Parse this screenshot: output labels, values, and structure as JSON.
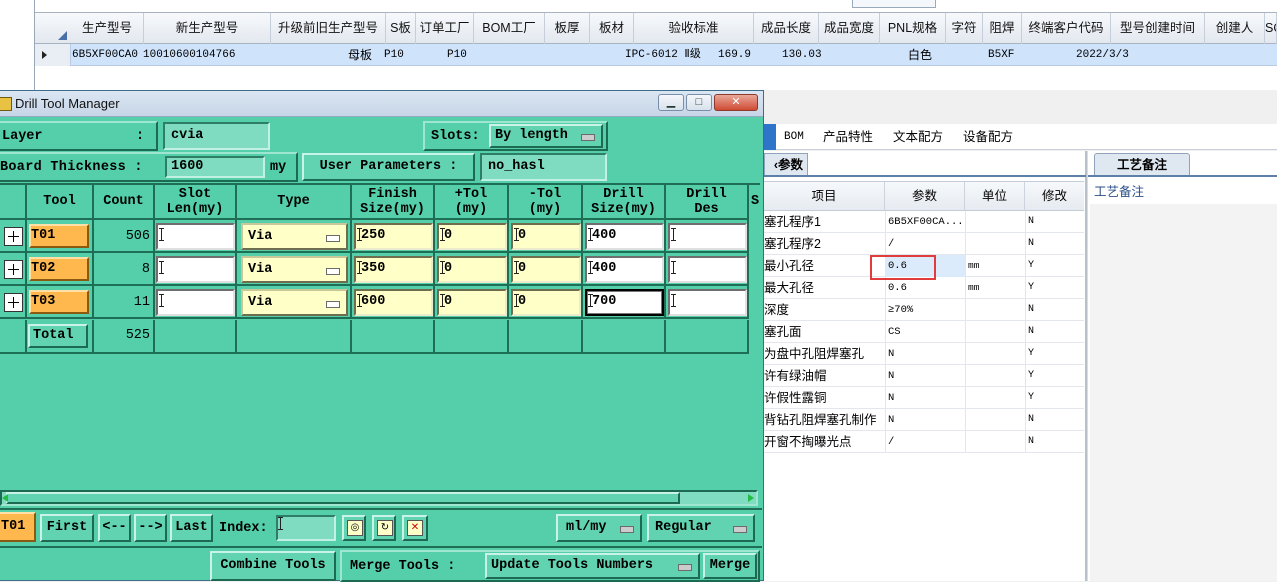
{
  "top_grid": {
    "columns": [
      "生产型号",
      "新生产型号",
      "升级前旧生产型号",
      "S板",
      "订单工厂",
      "BOM工厂",
      "板厚",
      "板材",
      "验收标准",
      "成品长度",
      "成品宽度",
      "PNL规格",
      "字符",
      "阻焊",
      "终端客户代码",
      "型号创建时间",
      "创建人",
      "SO"
    ],
    "row": {
      "model": "6B5XF00CA0",
      "new_model": "10010600104766",
      "s_board": "母板",
      "order_factory": "P10",
      "bom_factory": "P10",
      "acceptance": "IPC-6012 Ⅱ级",
      "length": "169.9",
      "width": "130.03",
      "char": "白色",
      "customer_code": "B5XF",
      "created": "2022/3/3"
    }
  },
  "sub_tabs": [
    "BOM",
    "产品特性",
    "文本配方",
    "设备配方"
  ],
  "param_panel": {
    "tab_label": "‹参数",
    "headers": [
      "项目",
      "参数",
      "单位",
      "修改"
    ],
    "rows": [
      {
        "item": "塞孔程序1",
        "value": "6B5XF00CA...",
        "unit": "",
        "mod": "N"
      },
      {
        "item": "塞孔程序2",
        "value": "/",
        "unit": "",
        "mod": "N"
      },
      {
        "item": "最小孔径",
        "value": "0.6",
        "unit": "mm",
        "mod": "Y"
      },
      {
        "item": "最大孔径",
        "value": "0.6",
        "unit": "mm",
        "mod": "Y"
      },
      {
        "item": "深度",
        "value": "≥70%",
        "unit": "",
        "mod": "N"
      },
      {
        "item": "塞孔面",
        "value": "CS",
        "unit": "",
        "mod": "N"
      },
      {
        "item": "为盘中孔阻焊塞孔",
        "value": "N",
        "unit": "",
        "mod": "Y"
      },
      {
        "item": "许有绿油帽",
        "value": "N",
        "unit": "",
        "mod": "Y"
      },
      {
        "item": "许假性露铜",
        "value": "N",
        "unit": "",
        "mod": "Y"
      },
      {
        "item": "背钻孔阻焊塞孔制作",
        "value": "N",
        "unit": "",
        "mod": "N"
      },
      {
        "item": "开窗不掏曝光点",
        "value": "/",
        "unit": "",
        "mod": "N"
      }
    ]
  },
  "craft_panel": {
    "tab_label": "工艺备注",
    "field_label": "工艺备注"
  },
  "dtm": {
    "title": "Drill Tool Manager",
    "layer_label": "Layer",
    "layer_value": "cvia",
    "slots_label": "Slots:",
    "slots_value": "By length",
    "thickness_label": "Board Thickness :",
    "thickness_value": "1600",
    "thickness_unit": "my",
    "user_params_label": "User Parameters :",
    "user_params_value": "no_hasl",
    "headers": {
      "tool": "Tool",
      "count": "Count",
      "slot": [
        "Slot",
        "Len(my)"
      ],
      "type": "Type",
      "finish": [
        "Finish",
        "Size(my)"
      ],
      "ptol": [
        "+Tol",
        "(my)"
      ],
      "ntol": [
        "-Tol",
        "(my)"
      ],
      "drill": [
        "Drill",
        "Size(my)"
      ],
      "des": [
        "Drill",
        "Des"
      ],
      "extra": "S"
    },
    "rows": [
      {
        "tool": "T01",
        "count": "506",
        "type": "Via",
        "finish": "250",
        "ptol": "0",
        "ntol": "0",
        "drill": "400"
      },
      {
        "tool": "T02",
        "count": "8",
        "type": "Via",
        "finish": "350",
        "ptol": "0",
        "ntol": "0",
        "drill": "400"
      },
      {
        "tool": "T03",
        "count": "11",
        "type": "Via",
        "finish": "600",
        "ptol": "0",
        "ntol": "0",
        "drill": "700"
      }
    ],
    "total_label": "Total",
    "total_count": "525",
    "nav": {
      "current": "T01",
      "first": "First",
      "prev": "<--",
      "next": "-->",
      "last": "Last",
      "index_label": "Index:",
      "units": "ml/my",
      "mode": "Regular"
    },
    "bottom": {
      "combine": "Combine Tools",
      "merge_label": "Merge Tools :",
      "merge_select": "Update Tools Numbers",
      "merge_btn": "Merge"
    }
  }
}
